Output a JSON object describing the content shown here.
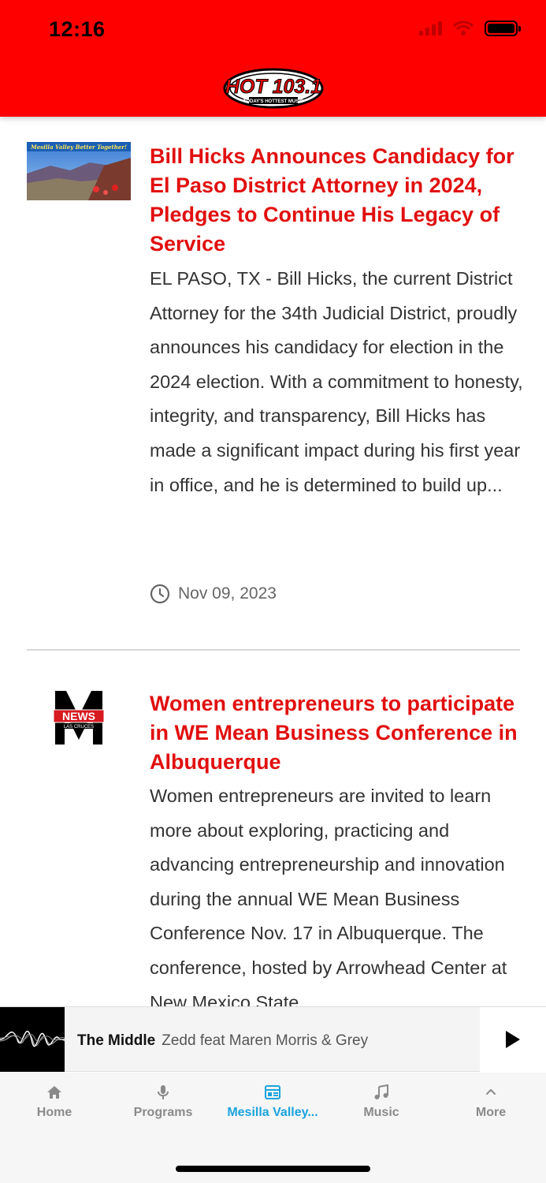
{
  "status_bar": {
    "time": "12:16"
  },
  "header": {
    "logo_text": "HOT 103.1",
    "logo_tagline": "TODAY'S HOTTEST MUSIC"
  },
  "articles": [
    {
      "thumb_caption": "Mesilla Valley Better Together!",
      "title": "Bill Hicks Announces Candidacy for El Paso District Attorney in 2024, Pledges to Continue His Legacy of Service",
      "body": "EL PASO, TX - Bill Hicks, the current District Attorney for the 34th Judicial District, proudly announces his candidacy for election in the 2024 election. With a commitment to honesty, integrity, and transparency, Bill Hicks has made a significant impact during his first year in office, and he is determined to build up...",
      "date": "Nov 09, 2023"
    },
    {
      "thumb_caption": "NEWS",
      "thumb_sub": "LAS CRUCES",
      "title": "Women entrepreneurs to participate in WE Mean Business Conference in Albuquerque",
      "body": "Women entrepreneurs are invited to learn more about exploring, practicing and advancing entrepreneurship and innovation during the annual WE Mean Business Conference Nov. 17 in Albuquerque. The conference, hosted by Arrowhead Center at New Mexico State",
      "date": ""
    }
  ],
  "player": {
    "title": "The Middle",
    "artist": "Zedd feat Maren Morris & Grey"
  },
  "tabs": [
    {
      "label": "Home",
      "icon": "home-icon"
    },
    {
      "label": "Programs",
      "icon": "microphone-icon"
    },
    {
      "label": "Mesilla Valley...",
      "icon": "newspaper-icon"
    },
    {
      "label": "Music",
      "icon": "music-note-icon"
    },
    {
      "label": "More",
      "icon": "chevron-up-icon"
    }
  ],
  "colors": {
    "header": "#ff0000",
    "title": "#e10f0f",
    "active_tab": "#1aa3dd"
  }
}
